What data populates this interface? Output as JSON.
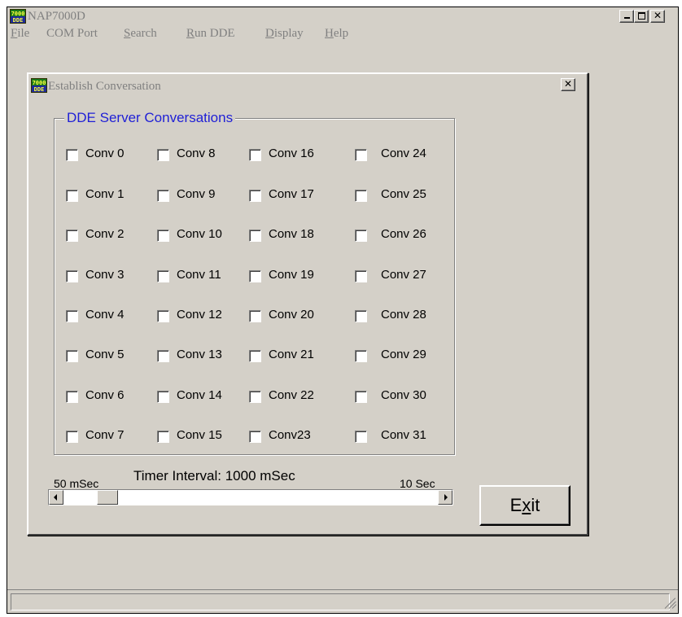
{
  "app": {
    "title": "NAP7000D",
    "icon": "nap7000-dde-app-icon",
    "icon_text_top": "7000",
    "icon_text_bottom": "DDE",
    "caption_buttons": [
      "minimize-icon",
      "maximize-icon",
      "close-icon"
    ]
  },
  "menubar": {
    "items": [
      {
        "label": "File",
        "mnemonic": "F",
        "rest": "ile"
      },
      {
        "label": "COM Port",
        "mnemonic": "",
        "rest": "COM Port"
      },
      {
        "label": "Search",
        "mnemonic": "S",
        "rest": "earch"
      },
      {
        "label": "Run DDE",
        "mnemonic": "R",
        "rest": "un DDE"
      },
      {
        "label": "Display",
        "mnemonic": "D",
        "rest": "isplay"
      },
      {
        "label": "Help",
        "mnemonic": "H",
        "rest": "elp"
      }
    ]
  },
  "dialog": {
    "title": "Establish Conversation",
    "close_icon": "close-icon",
    "group": {
      "legend": "DDE Server Conversations",
      "columns": [
        [
          "Conv 0",
          "Conv 1",
          "Conv 2",
          "Conv 3",
          "Conv 4",
          "Conv 5",
          "Conv 6",
          "Conv 7"
        ],
        [
          "Conv 8",
          "Conv 9",
          "Conv 10",
          "Conv 11",
          "Conv 12",
          "Conv 13",
          "Conv 14",
          "Conv 15"
        ],
        [
          "Conv 16",
          "Conv 17",
          "Conv 18",
          "Conv 19",
          "Conv 20",
          "Conv 21",
          "Conv 22",
          "Conv23"
        ],
        [
          "Conv 24",
          "Conv 25",
          "Conv 26",
          "Conv 27",
          "Conv 28",
          "Conv 29",
          "Conv 30",
          "Conv 31"
        ]
      ],
      "checked": []
    },
    "timer": {
      "label": "Timer Interval: 1000 mSec",
      "min_label": "50 mSec",
      "max_label": "10 Sec",
      "slider_fraction": 0.1
    },
    "exit_button": {
      "label": "Exit",
      "mnemonic": "x",
      "before": "E",
      "after": "it"
    }
  },
  "colors": {
    "face": "#d4d0c8",
    "legend_blue": "#1f1fd6",
    "inactive_title_text": "#808080"
  },
  "statusbar": {
    "text": ""
  }
}
